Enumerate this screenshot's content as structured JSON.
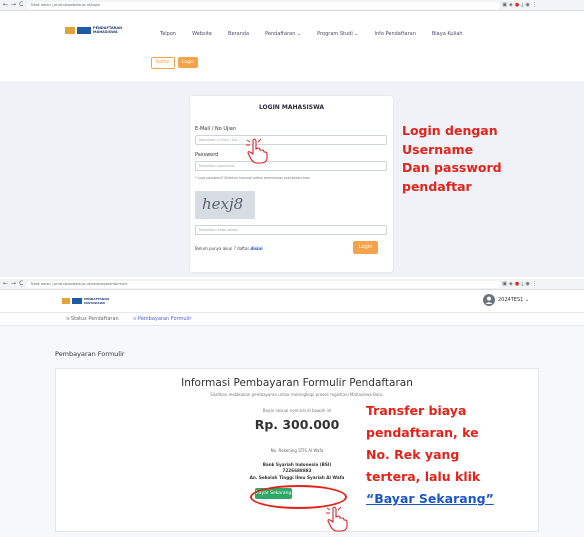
{
  "browser1": {
    "url": "Tidak aman | pmb.stiealwafa.ac.id/login",
    "back_glyph": "←",
    "fwd_glyph": "→",
    "reload_glyph": "C"
  },
  "site_header": {
    "logo_caption": "PENDAFTARAN MAHASISWA",
    "nav": [
      "Telpon",
      "Website",
      "Beranda",
      "Pendaftaran ⌄",
      "Program Studi ⌄",
      "Info Pendaftaran",
      "Biaya Kuliah"
    ],
    "daftar_label": "Daftar",
    "login_label": "Login"
  },
  "login_form": {
    "title": "LOGIN MAHASISWA",
    "email_label": "E-Mail / No Ujian",
    "email_placeholder": "Masukkan e-mail / No...",
    "password_label": "Password",
    "password_placeholder": "Masukkan password",
    "forgot_note": "* Lupa password? Silahkan hubungi admin penerimaan mahasiswa baru",
    "captcha_text": "hexj8",
    "captcha_placeholder": "Masukkan kode diatas",
    "register_prefix": "Belum punya akun ? daftar",
    "register_link": "disini",
    "login_button": "Login"
  },
  "annotation1": {
    "lines": [
      "Login dengan",
      "Username",
      "Dan password",
      "pendaftar"
    ]
  },
  "browser2": {
    "url": "Tidak aman | pmb.stiealwafa.ac.id/pembayaranformulir",
    "back_glyph": "←",
    "fwd_glyph": "→",
    "reload_glyph": "C"
  },
  "dashboard": {
    "user_label": "2024TES1 ⌄",
    "tab_status": "Status Pendaftaran",
    "tab_payment": "Pembayaran Formulir",
    "page_title": "Pembayaran Formulir"
  },
  "payment_info": {
    "title": "Informasi Pembayaran Formulir Pendaftaran",
    "subtitle": "Silahkan melakukan pembayaran untuk melengkapi proses registrasi Mahasiswa Baru.",
    "instruction": "Bayar sesuai nominal di bawah ini",
    "amount": "Rp. 300.000",
    "account_heading": "No. Rekening STIS Al Wafa",
    "bank": "Bank Syariah Indonesia (BSI)",
    "account_number": "7226688883",
    "account_name": "An. Sekolah Tinggi Ilmu Syariah Al Wafa",
    "pay_button": "Bayar Sekarang"
  },
  "annotation2": {
    "lines": [
      "Transfer biaya",
      "pendaftaran, ke",
      "No. Rek yang",
      "tertera, lalu klik"
    ],
    "link_text": "“Bayar Sekarang”"
  },
  "colors": {
    "accent_orange": "#f5a34a",
    "annotation_red": "#e2231a",
    "pay_green": "#2ea866",
    "link_blue": "#1b57c4"
  }
}
